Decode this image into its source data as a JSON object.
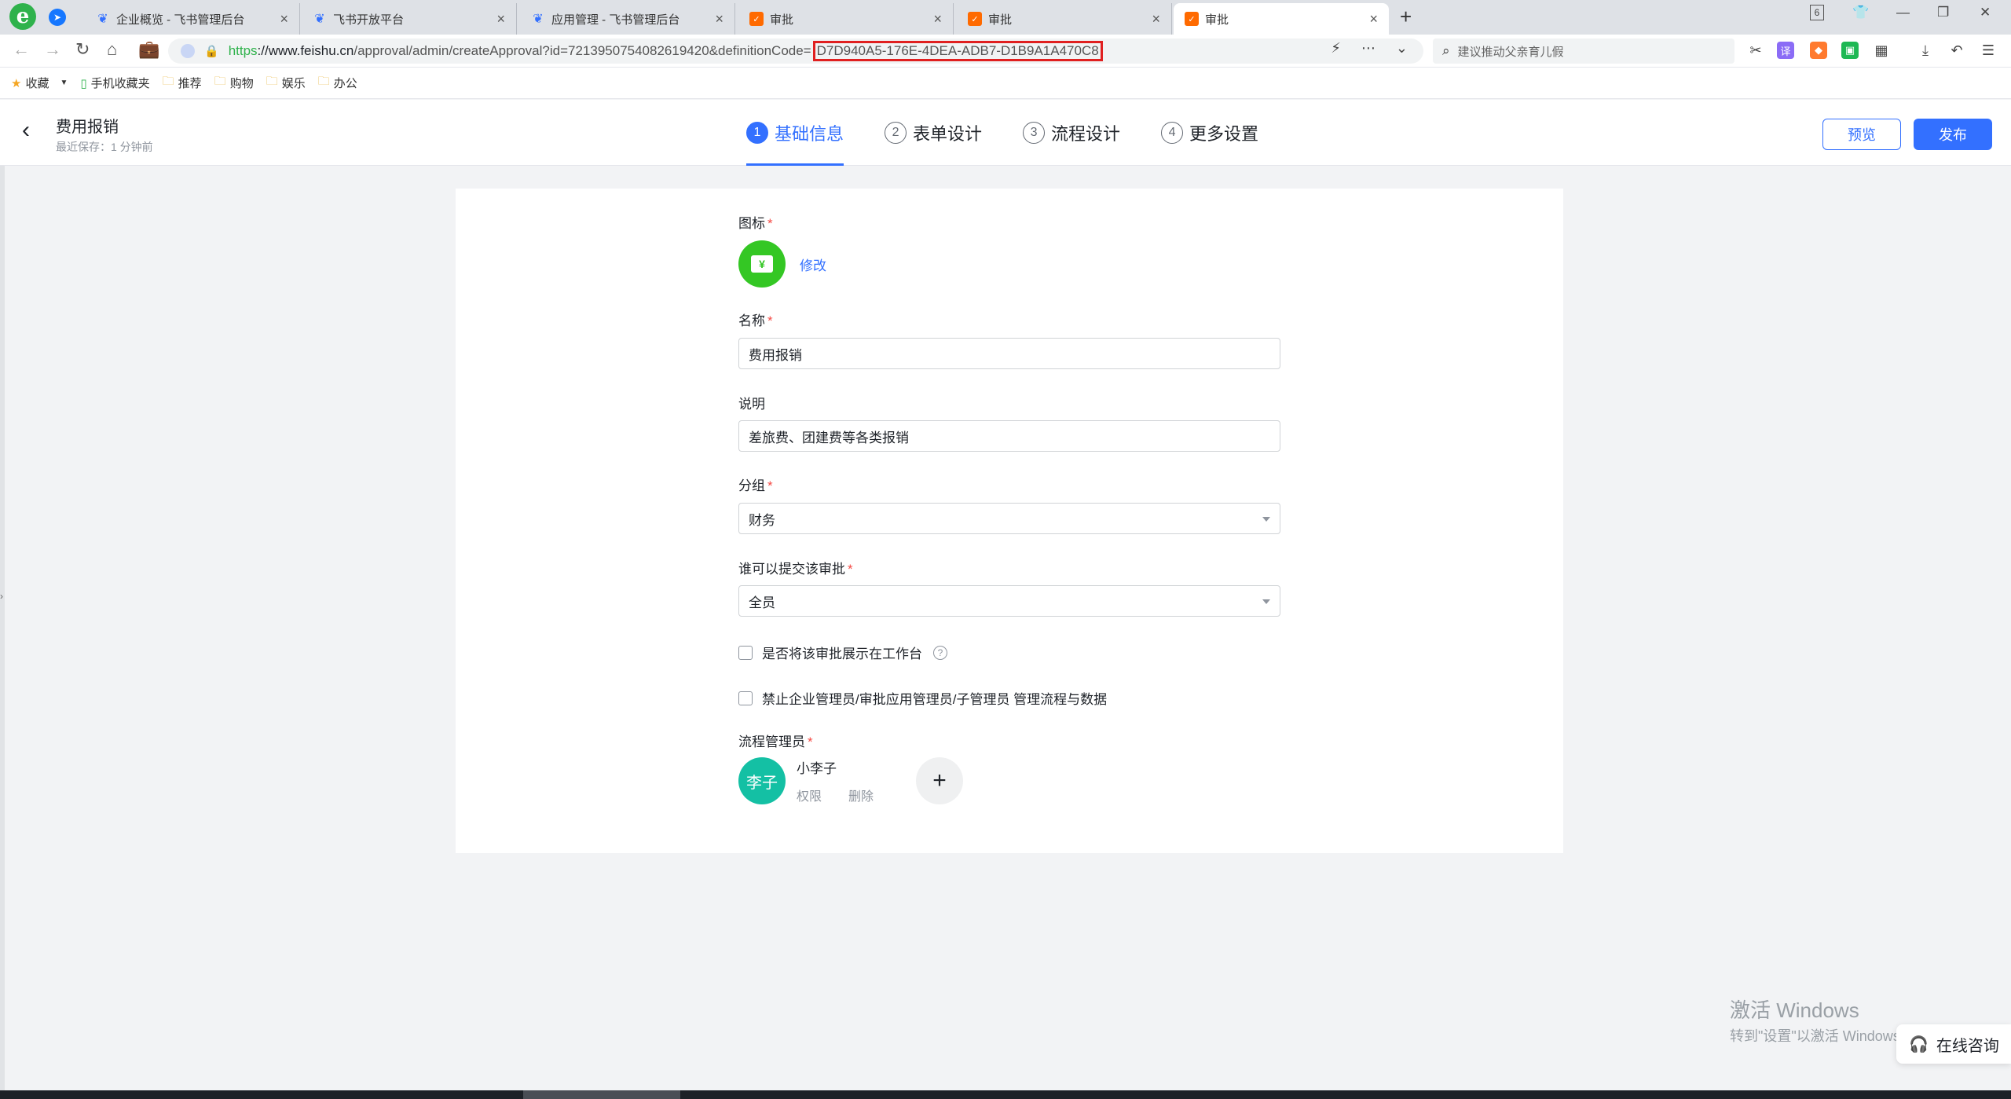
{
  "browser": {
    "tabs": [
      {
        "title": "企业概览 - 飞书管理后台",
        "favicon": "feishu-icon"
      },
      {
        "title": "飞书开放平台",
        "favicon": "feishu-icon"
      },
      {
        "title": "应用管理 - 飞书管理后台",
        "favicon": "feishu-icon"
      },
      {
        "title": "审批",
        "favicon": "approval-icon"
      },
      {
        "title": "审批",
        "favicon": "approval-icon"
      },
      {
        "title": "审批",
        "favicon": "approval-icon",
        "active": true
      }
    ],
    "tab_count_badge": "6",
    "url": {
      "scheme": "https",
      "host": "://www.feishu.cn",
      "path": "/approval/admin/createApproval?id=7213950754082619420&definitionCode=",
      "highlighted_code": "D7D940A5-176E-4DEA-ADB7-D1B9A1A470C8"
    },
    "search_placeholder": "建议推动父亲育儿假",
    "bookmarks": [
      {
        "label": "收藏",
        "icon": "star-icon"
      },
      {
        "label": "手机收藏夹",
        "icon": "phone-icon"
      },
      {
        "label": "推荐",
        "icon": "folder-icon"
      },
      {
        "label": "购物",
        "icon": "folder-icon"
      },
      {
        "label": "娱乐",
        "icon": "folder-icon"
      },
      {
        "label": "办公",
        "icon": "folder-icon"
      }
    ]
  },
  "header": {
    "title": "费用报销",
    "subtitle": "最近保存：1 分钟前",
    "steps": [
      {
        "num": "1",
        "label": "基础信息",
        "active": true
      },
      {
        "num": "2",
        "label": "表单设计"
      },
      {
        "num": "3",
        "label": "流程设计"
      },
      {
        "num": "4",
        "label": "更多设置"
      }
    ],
    "preview_label": "预览",
    "publish_label": "发布"
  },
  "form": {
    "icon_label": "图标",
    "icon_edit": "修改",
    "icon_glyph": "¥",
    "name_label": "名称",
    "name_value": "费用报销",
    "desc_label": "说明",
    "desc_value": "差旅费、团建费等各类报销",
    "group_label": "分组",
    "group_value": "财务",
    "submitter_label": "谁可以提交该审批",
    "submitter_value": "全员",
    "show_in_workbench": "是否将该审批展示在工作台",
    "forbid_admin": "禁止企业管理员/审批应用管理员/子管理员 管理流程与数据",
    "admin_label": "流程管理员",
    "admin": {
      "avatar_text": "李子",
      "name": "小李子",
      "perm": "权限",
      "delete": "删除"
    }
  },
  "overlay": {
    "watermark_line1": "激活 Windows",
    "watermark_line2": "转到\"设置\"以激活 Windows。",
    "consult": "在线咨询"
  },
  "colors": {
    "primary": "#3370ff",
    "required": "#f54a45",
    "icon_bg": "#34c724",
    "avatar_bg": "#14c0a4",
    "highlight_border": "#e02020"
  }
}
